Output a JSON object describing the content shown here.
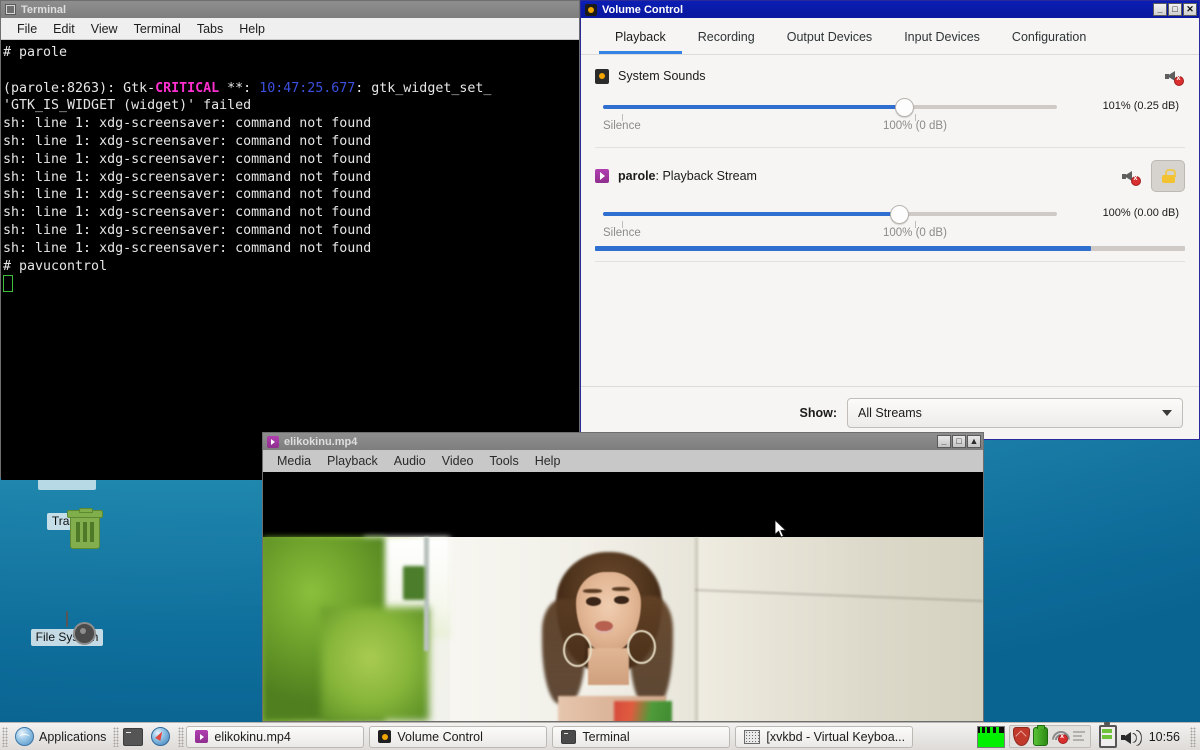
{
  "desktop": {
    "icons": [
      {
        "label": "Trash",
        "icon": "trash-icon"
      },
      {
        "label": "File System",
        "icon": "drive-icon"
      }
    ]
  },
  "terminal": {
    "title": "Terminal",
    "icon": "terminal-icon",
    "menu": [
      "File",
      "Edit",
      "View",
      "Terminal",
      "Tabs",
      "Help"
    ],
    "window_buttons": [
      "_",
      "□",
      "✕"
    ],
    "lines": [
      {
        "type": "plain",
        "text": "# parole"
      },
      {
        "type": "plain",
        "text": ""
      },
      {
        "type": "gtk",
        "pre": "(parole:8263): Gtk-",
        "crit": "CRITICAL",
        "mid": " **: ",
        "time": "10:47:25.677",
        "post": ": gtk_widget_set_"
      },
      {
        "type": "plain",
        "text": "'GTK_IS_WIDGET (widget)' failed"
      },
      {
        "type": "plain",
        "text": "sh: line 1: xdg-screensaver: command not found"
      },
      {
        "type": "plain",
        "text": "sh: line 1: xdg-screensaver: command not found"
      },
      {
        "type": "plain",
        "text": "sh: line 1: xdg-screensaver: command not found"
      },
      {
        "type": "plain",
        "text": "sh: line 1: xdg-screensaver: command not found"
      },
      {
        "type": "plain",
        "text": "sh: line 1: xdg-screensaver: command not found"
      },
      {
        "type": "plain",
        "text": "sh: line 1: xdg-screensaver: command not found"
      },
      {
        "type": "plain",
        "text": "sh: line 1: xdg-screensaver: command not found"
      },
      {
        "type": "plain",
        "text": "sh: line 1: xdg-screensaver: command not found"
      },
      {
        "type": "plain",
        "text": "# pavucontrol"
      }
    ]
  },
  "volume_control": {
    "title": "Volume Control",
    "icon": "pavucontrol-icon",
    "window_buttons": {
      "minimize": "_",
      "maximize": "□",
      "close": "✕"
    },
    "tabs": [
      {
        "label": "Playback",
        "active": true
      },
      {
        "label": "Recording",
        "active": false
      },
      {
        "label": "Output Devices",
        "active": false
      },
      {
        "label": "Input Devices",
        "active": false
      },
      {
        "label": "Configuration",
        "active": false
      }
    ],
    "streams": [
      {
        "name": "System Sounds",
        "app": "",
        "icon": "system-sounds-icon",
        "volume_label": "101% (0.25 dB)",
        "volume_percent": 66,
        "silence_label": "Silence",
        "base_label": "100% (0 dB)",
        "muted": true,
        "has_lock": false,
        "has_peak": false,
        "peak_percent": 0
      },
      {
        "name": ": Playback Stream",
        "app": "parole",
        "icon": "parole-icon",
        "volume_label": "100% (0.00 dB)",
        "volume_percent": 65,
        "silence_label": "Silence",
        "base_label": "100% (0 dB)",
        "muted": true,
        "has_lock": true,
        "lock_icon": "lock-icon",
        "has_peak": true,
        "peak_percent": 84
      }
    ],
    "footer": {
      "show_label": "Show:",
      "selected": "All Streams"
    },
    "accent_color": "#3584e4"
  },
  "video_player": {
    "title": "elikokinu.mp4",
    "icon": "parole-icon",
    "menu": [
      "Media",
      "Playback",
      "Audio",
      "Video",
      "Tools",
      "Help"
    ],
    "window_buttons": {
      "minimize": "_",
      "maximize": "□",
      "close": "▲"
    }
  },
  "taskbar": {
    "start": {
      "label": "Applications",
      "icon": "globe-icon"
    },
    "launchers": [
      {
        "icon": "terminal-launcher-icon"
      },
      {
        "icon": "browser-launcher-icon"
      }
    ],
    "windows": [
      {
        "label": "elikokinu.mp4",
        "icon": "parole-icon",
        "active": false
      },
      {
        "label": "Volume Control",
        "icon": "pavucontrol-icon",
        "active": false
      },
      {
        "label": "Terminal",
        "icon": "terminal-icon",
        "active": false
      },
      {
        "label": "[xvkbd - Virtual Keyboa...",
        "icon": "keyboard-icon",
        "active": false
      }
    ],
    "tray": [
      {
        "icon": "cpu-graph-icon"
      },
      {
        "icon": "shield-icon"
      },
      {
        "icon": "battery-icon"
      },
      {
        "icon": "network-disconnected-icon"
      },
      {
        "icon": "list-icon"
      },
      {
        "icon": "battery-status-icon"
      },
      {
        "icon": "volume-icon"
      }
    ],
    "clock": "10:56"
  }
}
